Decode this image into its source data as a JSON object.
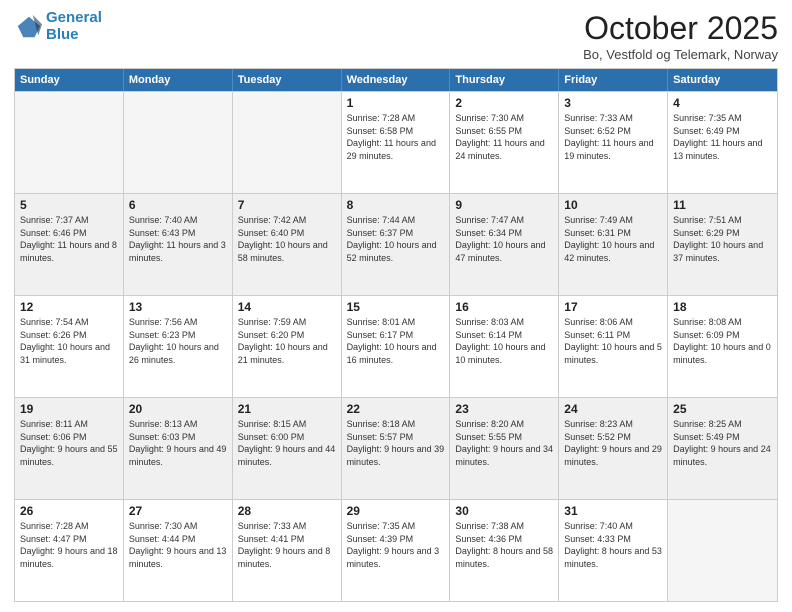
{
  "logo": {
    "line1": "General",
    "line2": "Blue"
  },
  "header": {
    "title": "October 2025",
    "subtitle": "Bo, Vestfold og Telemark, Norway"
  },
  "days": [
    "Sunday",
    "Monday",
    "Tuesday",
    "Wednesday",
    "Thursday",
    "Friday",
    "Saturday"
  ],
  "weeks": [
    [
      {
        "day": "",
        "info": "",
        "empty": true
      },
      {
        "day": "",
        "info": "",
        "empty": true
      },
      {
        "day": "",
        "info": "",
        "empty": true
      },
      {
        "day": "1",
        "info": "Sunrise: 7:28 AM\nSunset: 6:58 PM\nDaylight: 11 hours and 29 minutes."
      },
      {
        "day": "2",
        "info": "Sunrise: 7:30 AM\nSunset: 6:55 PM\nDaylight: 11 hours and 24 minutes."
      },
      {
        "day": "3",
        "info": "Sunrise: 7:33 AM\nSunset: 6:52 PM\nDaylight: 11 hours and 19 minutes."
      },
      {
        "day": "4",
        "info": "Sunrise: 7:35 AM\nSunset: 6:49 PM\nDaylight: 11 hours and 13 minutes."
      }
    ],
    [
      {
        "day": "5",
        "info": "Sunrise: 7:37 AM\nSunset: 6:46 PM\nDaylight: 11 hours and 8 minutes."
      },
      {
        "day": "6",
        "info": "Sunrise: 7:40 AM\nSunset: 6:43 PM\nDaylight: 11 hours and 3 minutes."
      },
      {
        "day": "7",
        "info": "Sunrise: 7:42 AM\nSunset: 6:40 PM\nDaylight: 10 hours and 58 minutes."
      },
      {
        "day": "8",
        "info": "Sunrise: 7:44 AM\nSunset: 6:37 PM\nDaylight: 10 hours and 52 minutes."
      },
      {
        "day": "9",
        "info": "Sunrise: 7:47 AM\nSunset: 6:34 PM\nDaylight: 10 hours and 47 minutes."
      },
      {
        "day": "10",
        "info": "Sunrise: 7:49 AM\nSunset: 6:31 PM\nDaylight: 10 hours and 42 minutes."
      },
      {
        "day": "11",
        "info": "Sunrise: 7:51 AM\nSunset: 6:29 PM\nDaylight: 10 hours and 37 minutes."
      }
    ],
    [
      {
        "day": "12",
        "info": "Sunrise: 7:54 AM\nSunset: 6:26 PM\nDaylight: 10 hours and 31 minutes."
      },
      {
        "day": "13",
        "info": "Sunrise: 7:56 AM\nSunset: 6:23 PM\nDaylight: 10 hours and 26 minutes."
      },
      {
        "day": "14",
        "info": "Sunrise: 7:59 AM\nSunset: 6:20 PM\nDaylight: 10 hours and 21 minutes."
      },
      {
        "day": "15",
        "info": "Sunrise: 8:01 AM\nSunset: 6:17 PM\nDaylight: 10 hours and 16 minutes."
      },
      {
        "day": "16",
        "info": "Sunrise: 8:03 AM\nSunset: 6:14 PM\nDaylight: 10 hours and 10 minutes."
      },
      {
        "day": "17",
        "info": "Sunrise: 8:06 AM\nSunset: 6:11 PM\nDaylight: 10 hours and 5 minutes."
      },
      {
        "day": "18",
        "info": "Sunrise: 8:08 AM\nSunset: 6:09 PM\nDaylight: 10 hours and 0 minutes."
      }
    ],
    [
      {
        "day": "19",
        "info": "Sunrise: 8:11 AM\nSunset: 6:06 PM\nDaylight: 9 hours and 55 minutes."
      },
      {
        "day": "20",
        "info": "Sunrise: 8:13 AM\nSunset: 6:03 PM\nDaylight: 9 hours and 49 minutes."
      },
      {
        "day": "21",
        "info": "Sunrise: 8:15 AM\nSunset: 6:00 PM\nDaylight: 9 hours and 44 minutes."
      },
      {
        "day": "22",
        "info": "Sunrise: 8:18 AM\nSunset: 5:57 PM\nDaylight: 9 hours and 39 minutes."
      },
      {
        "day": "23",
        "info": "Sunrise: 8:20 AM\nSunset: 5:55 PM\nDaylight: 9 hours and 34 minutes."
      },
      {
        "day": "24",
        "info": "Sunrise: 8:23 AM\nSunset: 5:52 PM\nDaylight: 9 hours and 29 minutes."
      },
      {
        "day": "25",
        "info": "Sunrise: 8:25 AM\nSunset: 5:49 PM\nDaylight: 9 hours and 24 minutes."
      }
    ],
    [
      {
        "day": "26",
        "info": "Sunrise: 7:28 AM\nSunset: 4:47 PM\nDaylight: 9 hours and 18 minutes."
      },
      {
        "day": "27",
        "info": "Sunrise: 7:30 AM\nSunset: 4:44 PM\nDaylight: 9 hours and 13 minutes."
      },
      {
        "day": "28",
        "info": "Sunrise: 7:33 AM\nSunset: 4:41 PM\nDaylight: 9 hours and 8 minutes."
      },
      {
        "day": "29",
        "info": "Sunrise: 7:35 AM\nSunset: 4:39 PM\nDaylight: 9 hours and 3 minutes."
      },
      {
        "day": "30",
        "info": "Sunrise: 7:38 AM\nSunset: 4:36 PM\nDaylight: 8 hours and 58 minutes."
      },
      {
        "day": "31",
        "info": "Sunrise: 7:40 AM\nSunset: 4:33 PM\nDaylight: 8 hours and 53 minutes."
      },
      {
        "day": "",
        "info": "",
        "empty": true
      }
    ]
  ]
}
